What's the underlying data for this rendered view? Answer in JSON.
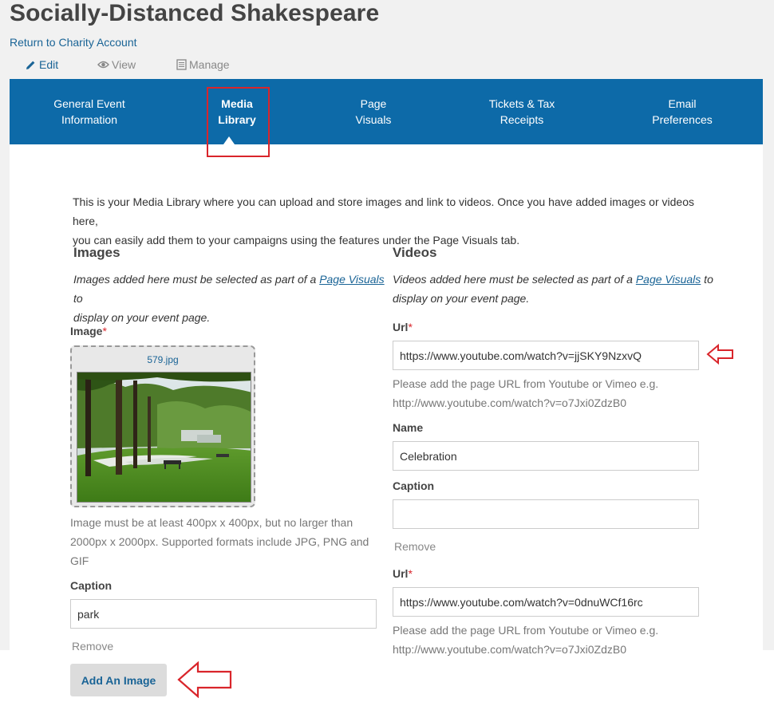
{
  "header": {
    "title": "Socially-Distanced Shakespeare",
    "return_link": "Return to Charity Account"
  },
  "mode_tabs": [
    {
      "label": "Edit",
      "icon": "pencil-icon",
      "active": true
    },
    {
      "label": "View",
      "icon": "eye-icon",
      "active": false
    },
    {
      "label": "Manage",
      "icon": "document-icon",
      "active": false
    }
  ],
  "nav": {
    "items": [
      {
        "line1": "General Event",
        "line2": "Information"
      },
      {
        "line1": "Media",
        "line2": "Library"
      },
      {
        "line1": "Page",
        "line2": "Visuals"
      },
      {
        "line1": "Tickets & Tax",
        "line2": "Receipts"
      },
      {
        "line1": "Email",
        "line2": "Preferences"
      }
    ],
    "active_index": 1
  },
  "intro": {
    "line1": "This is your Media Library where you can upload and store images and link to videos. Once you have added images or videos here,",
    "line2": "you can easily add them to your campaigns using the features under the Page Visuals tab."
  },
  "images": {
    "heading": "Images",
    "note_pre": "Images added here must be selected as part of a ",
    "note_link": "Page Visuals",
    "note_post": " to",
    "note_line2": "display on your event page.",
    "image_label": "Image",
    "required_mark": "*",
    "file_name": "579.jpg",
    "help_line1": "Image must be at least 400px x 400px, but no larger than",
    "help_line2": "2000px x 2000px. Supported formats include JPG, PNG and",
    "help_line3": "GIF",
    "caption_label": "Caption",
    "caption_value": "park",
    "remove_label": "Remove",
    "add_button": "Add An Image"
  },
  "videos": {
    "heading": "Videos",
    "note_pre": "Videos added here must be selected as part of a ",
    "note_link": "Page Visuals",
    "note_post": " to",
    "note_line2": "display on your event page.",
    "url_label": "Url",
    "required_mark": "*",
    "help_line1": "Please add the page URL from Youtube or Vimeo e.g.",
    "help_line2": "http://www.youtube.com/watch?v=o7Jxi0ZdzB0",
    "name_label": "Name",
    "caption_label": "Caption",
    "remove_label": "Remove",
    "entries": [
      {
        "url": "https://www.youtube.com/watch?v=jjSKY9NzxvQ",
        "name": "Celebration",
        "caption": ""
      },
      {
        "url": "https://www.youtube.com/watch?v=0dnuWCf16rc"
      }
    ]
  },
  "colors": {
    "nav_bg": "#0d6aa8",
    "link": "#1a6496",
    "annotation_red": "#d9252b",
    "page_bg": "#f1f1f1"
  }
}
